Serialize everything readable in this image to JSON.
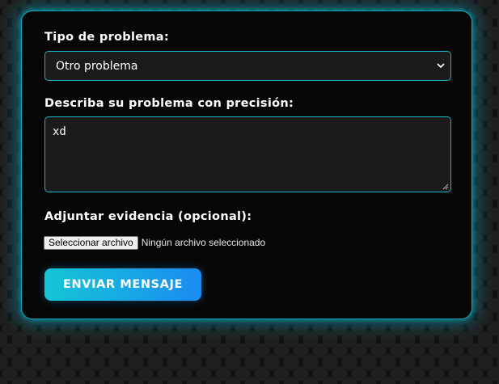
{
  "form": {
    "type_label": "Tipo de problema:",
    "type_selected": "Otro problema",
    "description_label": "Describa su problema con precisión:",
    "description_value": "xd",
    "attach_label": "Adjuntar evidencia (opcional):",
    "file_button_label": "Seleccionar archivo",
    "file_status": "Ningún archivo seleccionado",
    "submit_label": "ENVIAR MENSAJE"
  },
  "colors": {
    "accent": "#17b7c4",
    "button_gradient_start": "#15c6d6",
    "button_gradient_end": "#1a8cf2",
    "panel_background": "#070707"
  },
  "icons": {
    "select_arrow": "chevron-down-icon",
    "textarea_resize": "resize-grip-icon"
  }
}
